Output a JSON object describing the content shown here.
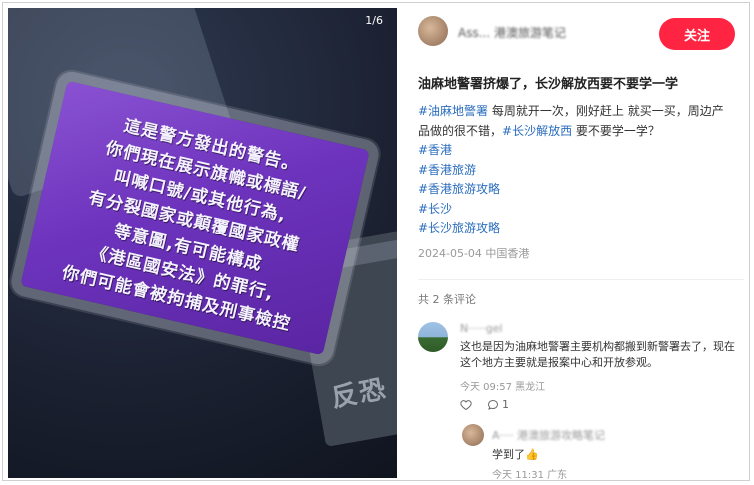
{
  "photo": {
    "counter": "1/6",
    "card_lines": [
      "這是警方發出的警告。",
      "你們現在展示旗幟或標語/",
      "叫喊口號/或其他行為,",
      "有分裂國家或顛覆國家政權",
      "等意圖,有可能構成",
      "《港區國安法》的罪行,",
      "你們可能會被拘捕及刑事檢控"
    ],
    "patch_text": "反恐"
  },
  "post": {
    "author": "Ass... 港澳旅游笔记",
    "follow_label": "关注",
    "title": "油麻地警署挤爆了，长沙解放西要不要学一学",
    "body_tag1": "#油麻地警署",
    "body_text1": " 每周就开一次，刚好赶上 就买一买，周边产品做的很不错，",
    "body_tag2": "#长沙解放西",
    "body_text2": " 要不要学一学？",
    "tags": [
      "#香港",
      "#香港旅游",
      "#香港旅游攻略",
      "#长沙",
      "#长沙旅游攻略"
    ],
    "date": "2024-05-04 中国香港"
  },
  "comments": {
    "count_label": "共 2 条评论",
    "first": {
      "name": "N·····gel",
      "text": "这也是因为油麻地警署主要机构都搬到新警署去了，现在这个地方主要就是报案中心和开放参观。",
      "meta": "今天 09:57 黑龙江",
      "like_count": "",
      "reply_count": "1"
    },
    "reply": {
      "name": "A···· 港澳旅游攻略笔记",
      "text": "学到了👍",
      "meta": "今天 11:31 广东"
    }
  },
  "colors": {
    "accent": "#ff2442",
    "tag": "#2a6dbd"
  }
}
